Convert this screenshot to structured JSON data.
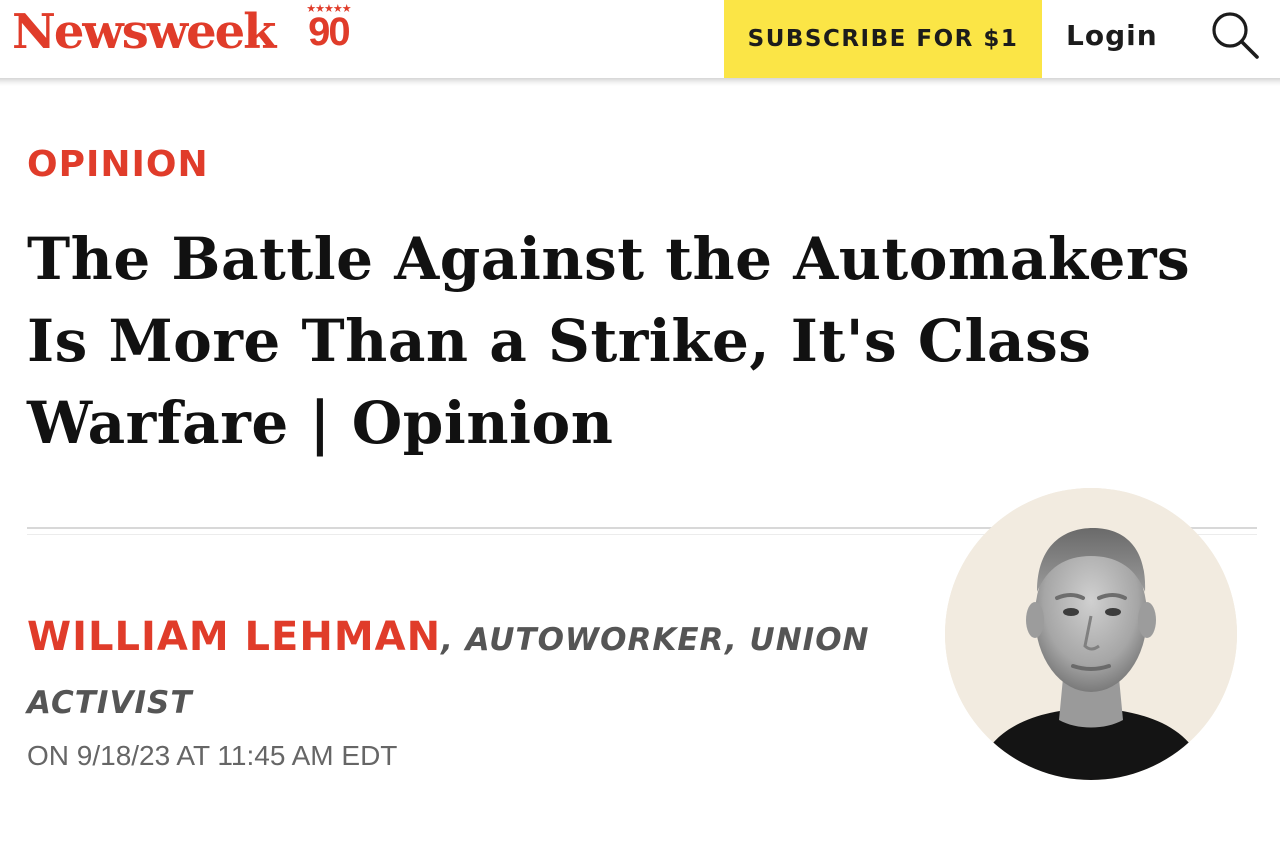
{
  "header": {
    "brand_name": "Newsweek",
    "brand_anniversary": "90",
    "brand_stars": "★★★★★",
    "subscribe_label": "SUBSCRIBE FOR $1",
    "login_label": "Login",
    "search_icon": "search-icon",
    "accent_color": "#e03c2a",
    "subscribe_color": "#fbe546"
  },
  "article": {
    "section": "OPINION",
    "headline": "The Battle Against the Automakers Is More Than a Strike, It's Class Warfare | Opinion",
    "author_name": "WILLIAM LEHMAN",
    "author_role": ", AUTOWORKER, UNION ACTIVIST",
    "dateline": "ON 9/18/23 AT 11:45 AM EDT"
  }
}
